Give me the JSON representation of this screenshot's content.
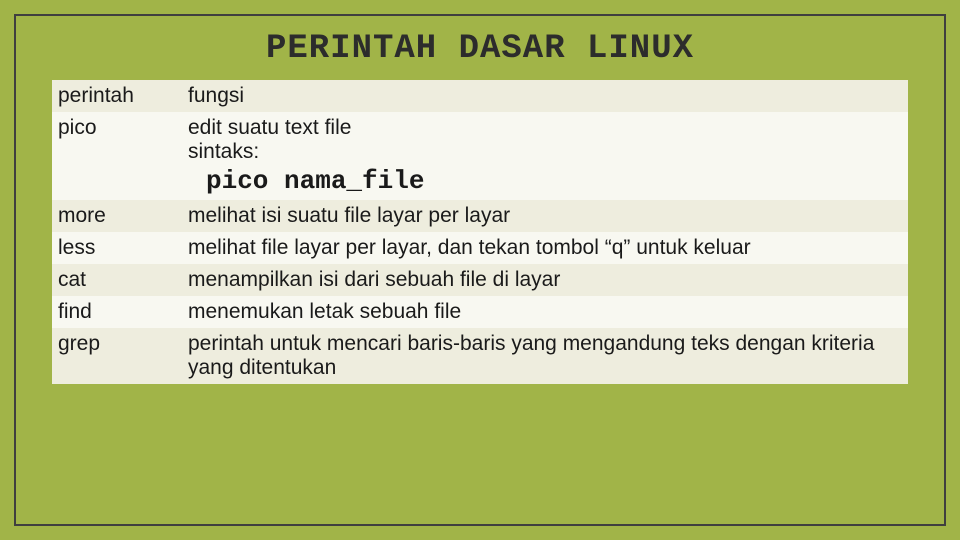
{
  "title": "PERINTAH DASAR LINUX",
  "header": {
    "cmd": "perintah",
    "func": "fungsi"
  },
  "rows": [
    {
      "cmd": "pico",
      "func": "edit suatu text file",
      "syntax_label": "sintaks:",
      "syntax_code": "pico nama_file",
      "cls": "row-b"
    },
    {
      "cmd": "more",
      "func": "melihat isi suatu file layar per layar",
      "cls": "row-a"
    },
    {
      "cmd": "less",
      "func": "melihat file layar per layar, dan tekan tombol “q” untuk keluar",
      "cls": "row-b"
    },
    {
      "cmd": "cat",
      "func": "menampilkan isi dari sebuah file di layar",
      "cls": "row-a"
    },
    {
      "cmd": "find",
      "func": "menemukan letak sebuah file",
      "cls": "row-b"
    },
    {
      "cmd": "grep",
      "func": "perintah untuk mencari baris-baris yang mengandung teks dengan kriteria yang ditentukan",
      "cls": "row-a"
    }
  ]
}
